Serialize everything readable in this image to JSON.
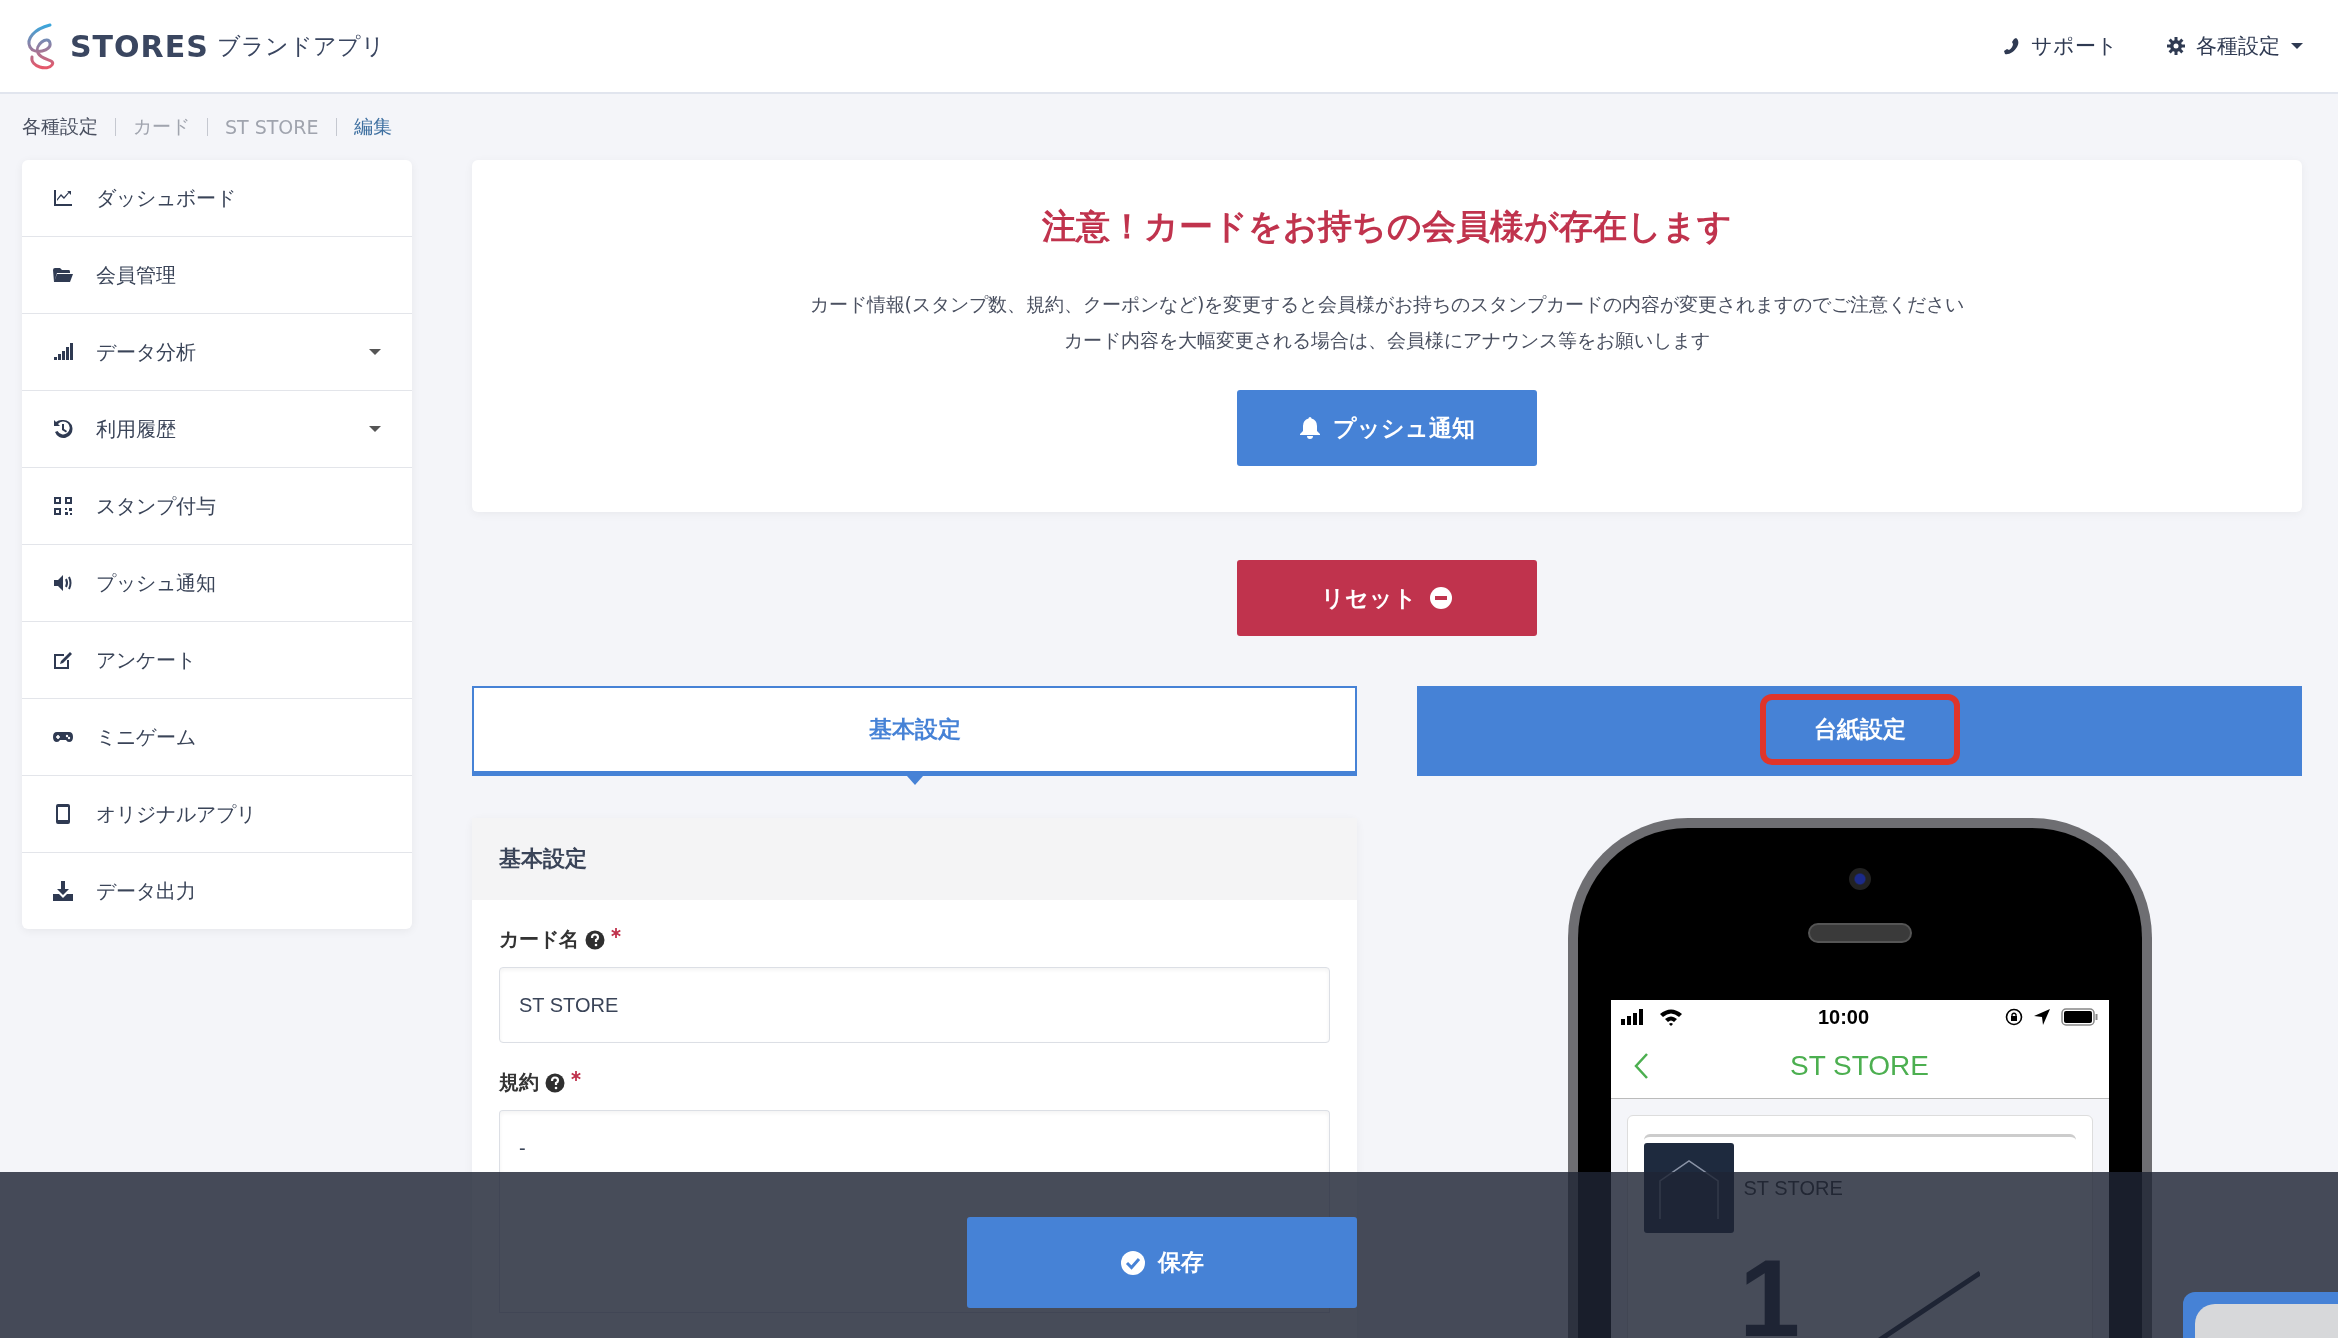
{
  "header": {
    "logo_text": "STORES",
    "logo_sub": "ブランドアプリ",
    "nav": [
      {
        "label": "サポート",
        "dropdown": false
      },
      {
        "label": "各種設定",
        "dropdown": true
      }
    ]
  },
  "breadcrumb": [
    {
      "label": "各種設定",
      "current": false
    },
    {
      "label": "カード",
      "current": false
    },
    {
      "label": "ST STORE",
      "current": false
    },
    {
      "label": "編集",
      "current": true
    }
  ],
  "sidebar": {
    "items": [
      {
        "label": "ダッシュボード",
        "has_submenu": false
      },
      {
        "label": "会員管理",
        "has_submenu": false
      },
      {
        "label": "データ分析",
        "has_submenu": true
      },
      {
        "label": "利用履歴",
        "has_submenu": true
      },
      {
        "label": "スタンプ付与",
        "has_submenu": false
      },
      {
        "label": "プッシュ通知",
        "has_submenu": false
      },
      {
        "label": "アンケート",
        "has_submenu": false
      },
      {
        "label": "ミニゲーム",
        "has_submenu": false
      },
      {
        "label": "オリジナルアプリ",
        "has_submenu": false
      },
      {
        "label": "データ出力",
        "has_submenu": false
      }
    ]
  },
  "notice": {
    "title": "注意！カードをお持ちの会員様が存在します",
    "lines": [
      "カード情報(スタンプ数、規約、クーポンなど)を変更すると会員様がお持ちのスタンプカードの内容が変更されますのでご注意ください",
      "カード内容を大幅変更される場合は、会員様にアナウンス等をお願いします"
    ],
    "button": "プッシュ通知"
  },
  "reset_button": "リセット",
  "tabs": [
    {
      "label": "基本設定",
      "selected": true,
      "highlighted": false
    },
    {
      "label": "台紙設定",
      "selected": false,
      "highlighted": true
    }
  ],
  "form": {
    "title": "基本設定",
    "fields": [
      {
        "label": "カード名",
        "required": true,
        "help": true,
        "value": "ST STORE"
      },
      {
        "label": "規約",
        "required": true,
        "help": true,
        "value": "-"
      }
    ]
  },
  "phone": {
    "time": "10:00",
    "nav_title": "ST STORE",
    "card_name": "ST STORE",
    "stamp_count": "1"
  },
  "save_button": "保存"
}
